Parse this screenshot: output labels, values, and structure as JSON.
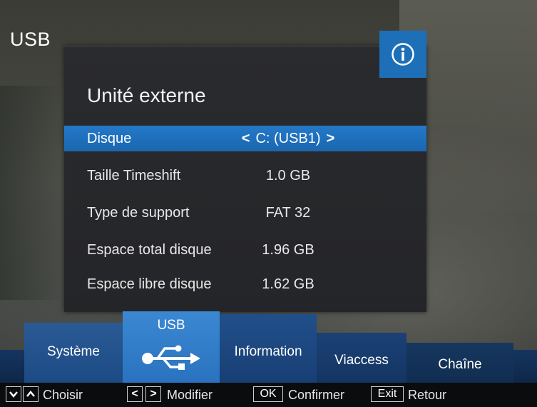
{
  "screen": {
    "title": "USB"
  },
  "dialog": {
    "title": "Unité externe",
    "info_icon": "info-circle-icon",
    "rows": [
      {
        "label": "Disque",
        "value": "C: (USB1)",
        "selected": true,
        "left_arrow": "<",
        "right_arrow": ">"
      },
      {
        "label": "Taille Timeshift",
        "value": "1.0 GB"
      },
      {
        "label": "Type de support",
        "value": "FAT 32"
      },
      {
        "label": "Espace total disque",
        "value": "1.96 GB"
      },
      {
        "label": "Espace libre disque",
        "value": "1.62 GB"
      }
    ]
  },
  "menu": {
    "tabs": [
      {
        "label": "Système"
      },
      {
        "label": "USB",
        "icon": "usb-icon",
        "active": true
      },
      {
        "label": "Information"
      },
      {
        "label": "Viaccess"
      },
      {
        "label": "Chaîne"
      }
    ]
  },
  "help": {
    "choose": {
      "keys": [
        "down-arrow-icon",
        "up-arrow-icon"
      ],
      "text": "Choisir"
    },
    "modify": {
      "keys": [
        "<",
        ">"
      ],
      "text": "Modifier"
    },
    "confirm": {
      "key": "OK",
      "text": "Confirmer"
    },
    "back": {
      "key": "Exit",
      "text": "Retour"
    }
  },
  "colors": {
    "accent": "#1d6fb8",
    "selected_row": "#2479c8",
    "active_tab": "#3b88d2",
    "menu_band": "#153560"
  }
}
